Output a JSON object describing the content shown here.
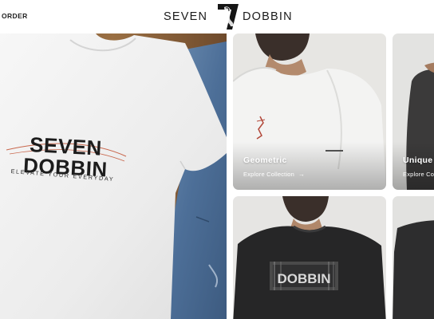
{
  "header": {
    "order_link": "ORDER",
    "logo_left": "SEVEN",
    "logo_right": "DOBBIN"
  },
  "hero": {
    "brand_line_1": "SEVEN",
    "brand_line_2": "DOBBIN",
    "tagline": "ELEVATE YOUR EVERYDAY"
  },
  "collections": [
    {
      "title": "Geometric",
      "cta": "Explore Collection",
      "cta_icon": "arrow-right-icon"
    },
    {
      "title": "Unique",
      "cta": "Explore Co"
    },
    {
      "print": "DOBBIN"
    }
  ],
  "colors": {
    "card_bg_light": "#e7e6e3",
    "card_bg_dark": "#2a2a2b",
    "wood": "#8a6239"
  }
}
